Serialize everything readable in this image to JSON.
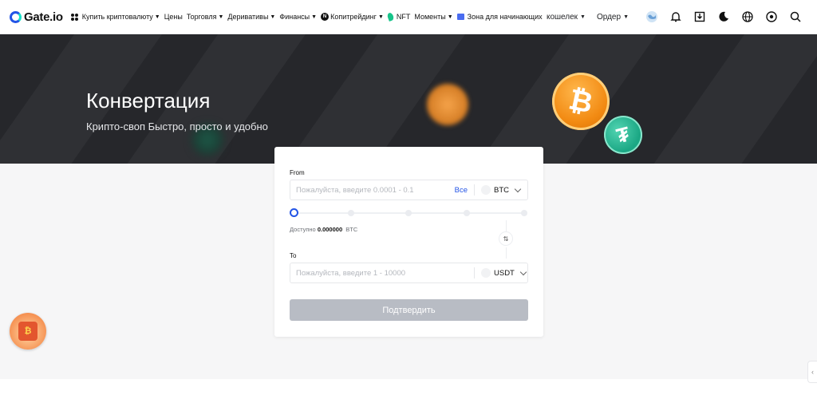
{
  "brand": {
    "name": "Gate.io"
  },
  "nav": {
    "items": [
      {
        "label": "Купить криптовалюту",
        "has_caret": true,
        "icon": "grid-icon"
      },
      {
        "label": "Цены",
        "has_caret": false
      },
      {
        "label": "Торговля",
        "has_caret": true
      },
      {
        "label": "Деривативы",
        "has_caret": true
      },
      {
        "label": "Финансы",
        "has_caret": true
      },
      {
        "label": "Копитрейдинг",
        "has_caret": true,
        "icon": "n-icon"
      },
      {
        "label": "NFT",
        "has_caret": false,
        "icon": "leaf-icon"
      },
      {
        "label": "Моменты",
        "has_caret": true
      },
      {
        "label": "Зона для начинающих",
        "has_caret": false,
        "icon": "zone-icon"
      }
    ],
    "wallet_label": "кошелек",
    "order_label": "Ордер",
    "icons": [
      "globe-avatar-icon",
      "bell-icon",
      "download-icon",
      "moon-icon",
      "language-icon",
      "settings-icon",
      "search-icon"
    ]
  },
  "hero": {
    "title": "Конвертация",
    "subtitle": "Крипто-своп Быстро, просто и удобно"
  },
  "convert": {
    "from_label": "From",
    "from_placeholder": "Пожалуйста, введите 0.0001 - 0.1",
    "all_label": "Все",
    "from_currency": "BTC",
    "available_label": "Доступно",
    "available_amount": "0.000000",
    "available_currency": "BTC",
    "to_label": "To",
    "to_placeholder": "Пожалуйста, введите 1 - 10000",
    "to_currency": "USDT",
    "confirm_label": "Подтвердить",
    "slider_percent": 0
  },
  "colors": {
    "accent": "#2354e6",
    "hero_bg": "#26272b",
    "button_disabled": "#b8bcc4"
  }
}
